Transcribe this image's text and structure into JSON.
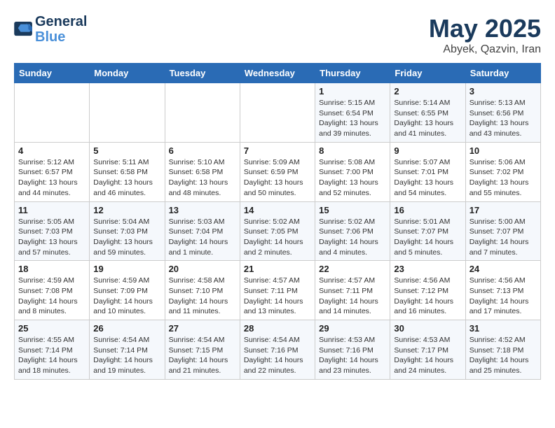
{
  "header": {
    "logo_line1": "General",
    "logo_line2": "Blue",
    "title": "May 2025",
    "subtitle": "Abyek, Qazvin, Iran"
  },
  "weekdays": [
    "Sunday",
    "Monday",
    "Tuesday",
    "Wednesday",
    "Thursday",
    "Friday",
    "Saturday"
  ],
  "rows": [
    [
      {
        "day": "",
        "info": ""
      },
      {
        "day": "",
        "info": ""
      },
      {
        "day": "",
        "info": ""
      },
      {
        "day": "",
        "info": ""
      },
      {
        "day": "1",
        "info": "Sunrise: 5:15 AM\nSunset: 6:54 PM\nDaylight: 13 hours\nand 39 minutes."
      },
      {
        "day": "2",
        "info": "Sunrise: 5:14 AM\nSunset: 6:55 PM\nDaylight: 13 hours\nand 41 minutes."
      },
      {
        "day": "3",
        "info": "Sunrise: 5:13 AM\nSunset: 6:56 PM\nDaylight: 13 hours\nand 43 minutes."
      }
    ],
    [
      {
        "day": "4",
        "info": "Sunrise: 5:12 AM\nSunset: 6:57 PM\nDaylight: 13 hours\nand 44 minutes."
      },
      {
        "day": "5",
        "info": "Sunrise: 5:11 AM\nSunset: 6:58 PM\nDaylight: 13 hours\nand 46 minutes."
      },
      {
        "day": "6",
        "info": "Sunrise: 5:10 AM\nSunset: 6:58 PM\nDaylight: 13 hours\nand 48 minutes."
      },
      {
        "day": "7",
        "info": "Sunrise: 5:09 AM\nSunset: 6:59 PM\nDaylight: 13 hours\nand 50 minutes."
      },
      {
        "day": "8",
        "info": "Sunrise: 5:08 AM\nSunset: 7:00 PM\nDaylight: 13 hours\nand 52 minutes."
      },
      {
        "day": "9",
        "info": "Sunrise: 5:07 AM\nSunset: 7:01 PM\nDaylight: 13 hours\nand 54 minutes."
      },
      {
        "day": "10",
        "info": "Sunrise: 5:06 AM\nSunset: 7:02 PM\nDaylight: 13 hours\nand 55 minutes."
      }
    ],
    [
      {
        "day": "11",
        "info": "Sunrise: 5:05 AM\nSunset: 7:03 PM\nDaylight: 13 hours\nand 57 minutes."
      },
      {
        "day": "12",
        "info": "Sunrise: 5:04 AM\nSunset: 7:03 PM\nDaylight: 13 hours\nand 59 minutes."
      },
      {
        "day": "13",
        "info": "Sunrise: 5:03 AM\nSunset: 7:04 PM\nDaylight: 14 hours\nand 1 minute."
      },
      {
        "day": "14",
        "info": "Sunrise: 5:02 AM\nSunset: 7:05 PM\nDaylight: 14 hours\nand 2 minutes."
      },
      {
        "day": "15",
        "info": "Sunrise: 5:02 AM\nSunset: 7:06 PM\nDaylight: 14 hours\nand 4 minutes."
      },
      {
        "day": "16",
        "info": "Sunrise: 5:01 AM\nSunset: 7:07 PM\nDaylight: 14 hours\nand 5 minutes."
      },
      {
        "day": "17",
        "info": "Sunrise: 5:00 AM\nSunset: 7:07 PM\nDaylight: 14 hours\nand 7 minutes."
      }
    ],
    [
      {
        "day": "18",
        "info": "Sunrise: 4:59 AM\nSunset: 7:08 PM\nDaylight: 14 hours\nand 8 minutes."
      },
      {
        "day": "19",
        "info": "Sunrise: 4:59 AM\nSunset: 7:09 PM\nDaylight: 14 hours\nand 10 minutes."
      },
      {
        "day": "20",
        "info": "Sunrise: 4:58 AM\nSunset: 7:10 PM\nDaylight: 14 hours\nand 11 minutes."
      },
      {
        "day": "21",
        "info": "Sunrise: 4:57 AM\nSunset: 7:11 PM\nDaylight: 14 hours\nand 13 minutes."
      },
      {
        "day": "22",
        "info": "Sunrise: 4:57 AM\nSunset: 7:11 PM\nDaylight: 14 hours\nand 14 minutes."
      },
      {
        "day": "23",
        "info": "Sunrise: 4:56 AM\nSunset: 7:12 PM\nDaylight: 14 hours\nand 16 minutes."
      },
      {
        "day": "24",
        "info": "Sunrise: 4:56 AM\nSunset: 7:13 PM\nDaylight: 14 hours\nand 17 minutes."
      }
    ],
    [
      {
        "day": "25",
        "info": "Sunrise: 4:55 AM\nSunset: 7:14 PM\nDaylight: 14 hours\nand 18 minutes."
      },
      {
        "day": "26",
        "info": "Sunrise: 4:54 AM\nSunset: 7:14 PM\nDaylight: 14 hours\nand 19 minutes."
      },
      {
        "day": "27",
        "info": "Sunrise: 4:54 AM\nSunset: 7:15 PM\nDaylight: 14 hours\nand 21 minutes."
      },
      {
        "day": "28",
        "info": "Sunrise: 4:54 AM\nSunset: 7:16 PM\nDaylight: 14 hours\nand 22 minutes."
      },
      {
        "day": "29",
        "info": "Sunrise: 4:53 AM\nSunset: 7:16 PM\nDaylight: 14 hours\nand 23 minutes."
      },
      {
        "day": "30",
        "info": "Sunrise: 4:53 AM\nSunset: 7:17 PM\nDaylight: 14 hours\nand 24 minutes."
      },
      {
        "day": "31",
        "info": "Sunrise: 4:52 AM\nSunset: 7:18 PM\nDaylight: 14 hours\nand 25 minutes."
      }
    ]
  ]
}
